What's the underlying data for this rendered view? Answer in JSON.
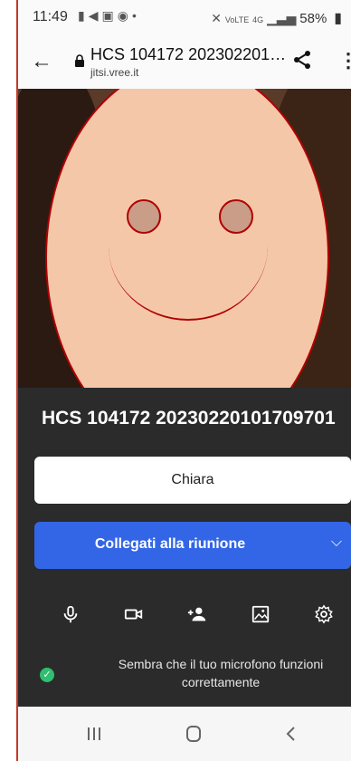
{
  "status_bar": {
    "time": "11:49",
    "left_icons": [
      "video-call-icon",
      "image-icon",
      "app-icon",
      "dot-icon"
    ],
    "right_icons": [
      "mute-icon",
      "volte-icon",
      "4g-icon",
      "signal-icon"
    ],
    "battery_label": "58%"
  },
  "browser": {
    "page_title": "HCS 104172 202302201…",
    "domain": "jitsi.vree.it"
  },
  "prejoin": {
    "room_name": "HCS 104172 20230220101709701",
    "name_value": "Chiara",
    "join_label": "Collegati alla riunione",
    "status_message": "Sembra che il tuo microfono funzioni correttamente"
  },
  "toolbar": {
    "items": [
      "microphone-icon",
      "camera-icon",
      "invite-icon",
      "background-icon",
      "settings-icon"
    ]
  },
  "nav": {
    "items": [
      "recent-apps-icon",
      "home-icon",
      "back-icon"
    ]
  },
  "colors": {
    "join_button": "#3366e6",
    "panel_bg": "#2b2b2b",
    "status_ok": "#2fbf71",
    "annotation_red": "#b00000"
  }
}
